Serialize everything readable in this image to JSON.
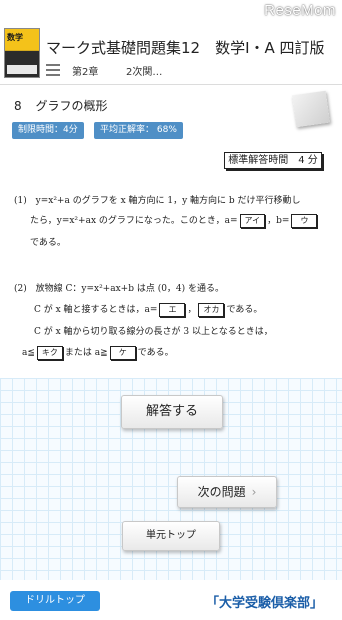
{
  "watermark": "ReseMom",
  "header": {
    "book_title": "数学",
    "title": "マーク式基礎問題集12　数学Ⅰ・A 四訂版",
    "chapter": "第2章",
    "section": "2次関…"
  },
  "problem": {
    "number": "8",
    "heading": "グラフの概形",
    "time_limit": "制限時間：4分",
    "accuracy": "平均正解率： 68%",
    "standard_time": "標準解答時間　4 分",
    "q1": {
      "label": "(1)",
      "line1": "y=x²+a のグラフを x 軸方向に 1，y 軸方向に b だけ平行移動し",
      "line2_a": "たら，y=x²+ax のグラフになった。このとき，a=",
      "box_a": "アイ",
      "line2_b": "，b=",
      "box_b": "ウ",
      "line3": "である。"
    },
    "q2": {
      "label": "(2)",
      "line1": "放物線 C：y=x²+ax+b は点 (0，4) を通る。",
      "line2_a": "C が x 軸と接するときは，a=",
      "box_e": "エ",
      "line2_sep": "，",
      "box_oka": "オカ",
      "line2_b": "である。",
      "line3": "C が x 軸から切り取る線分の長さが 3 以上となるときは，",
      "line4_a": "a≦",
      "box_kiku": "キク",
      "line4_b": "または a≧",
      "box_ke": "ケ",
      "line4_c": "である。"
    }
  },
  "buttons": {
    "answer": "解答する",
    "next": "次の問題",
    "next_chevron": "›",
    "unit_top": "単元トップ"
  },
  "footer": {
    "drill_top": "ドリルトップ",
    "brand": "「大学受験倶楽部」"
  },
  "colors": {
    "accent_blue": "#2d8fe0",
    "pill_blue": "#4f8fc6",
    "brand_blue": "#1b5ea8"
  }
}
